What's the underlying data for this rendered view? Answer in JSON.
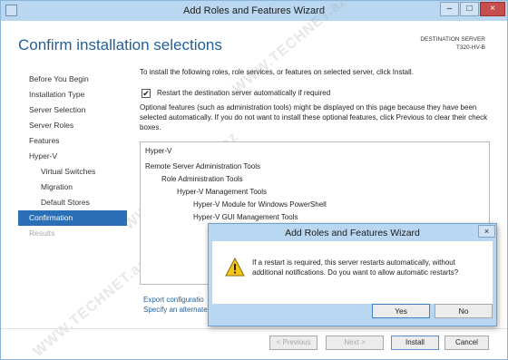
{
  "window": {
    "title": "Add Roles and Features Wizard",
    "controls": {
      "minimize": "–",
      "maximize": "□",
      "close": "×"
    }
  },
  "page_title": "Confirm installation selections",
  "destination": {
    "label": "DESTINATION SERVER",
    "server": "T320-HV-B"
  },
  "sidebar": {
    "items": [
      {
        "label": "Before You Begin",
        "state": "normal"
      },
      {
        "label": "Installation Type",
        "state": "normal"
      },
      {
        "label": "Server Selection",
        "state": "normal"
      },
      {
        "label": "Server Roles",
        "state": "normal"
      },
      {
        "label": "Features",
        "state": "normal"
      },
      {
        "label": "Hyper-V",
        "state": "normal"
      },
      {
        "label": "Virtual Switches",
        "state": "normal"
      },
      {
        "label": "Migration",
        "state": "normal"
      },
      {
        "label": "Default Stores",
        "state": "normal"
      },
      {
        "label": "Confirmation",
        "state": "active"
      },
      {
        "label": "Results",
        "state": "disabled"
      }
    ]
  },
  "content": {
    "intro": "To install the following roles, role services, or features on selected server, click Install.",
    "restart_checkbox": {
      "label": "Restart the destination server automatically if required",
      "checked": true,
      "mark": "✔"
    },
    "optional_text": "Optional features (such as administration tools) might be displayed on this page because they have been selected automatically. If you do not want to install these optional features, click Previous to clear their check boxes.",
    "features": [
      "Hyper-V",
      "Remote Server Administration Tools",
      "Role Administration Tools",
      "Hyper-V Management Tools",
      "Hyper-V Module for Windows PowerShell",
      "Hyper-V GUI Management Tools"
    ],
    "links": {
      "export": "Export configuratio",
      "alternate": "Specify an alternate"
    }
  },
  "buttons": {
    "previous": "< Previous",
    "next": "Next >",
    "install": "Install",
    "cancel": "Cancel"
  },
  "watermark": "WWW.TECHNET.az",
  "dialog": {
    "title": "Add Roles and Features Wizard",
    "close": "×",
    "icon": "warning-icon",
    "message": "If a restart is required, this server restarts automatically, without additional notifications. Do you want to allow automatic restarts?",
    "yes": "Yes",
    "no": "No"
  },
  "colors": {
    "title_blue": "#1f5f9a",
    "active_nav": "#2b6fb6",
    "titlebar": "#b9d7f0",
    "warning_yellow": "#f5c518"
  }
}
